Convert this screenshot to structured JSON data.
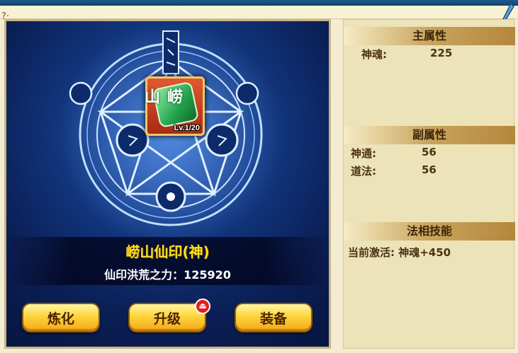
{
  "top_bar": {
    "corner_glyph": "?·"
  },
  "seal": {
    "icon_char": "崂山",
    "level": "Lv.1/20",
    "name": "崂山仙印(神)",
    "power_text": "仙印洪荒之力：125920"
  },
  "buttons": {
    "refine": "炼化",
    "upgrade": "升级",
    "equip": "装备",
    "upgrade_badge": "⏏"
  },
  "main_attr": {
    "title": "主属性",
    "rows": [
      {
        "label": "神魂:",
        "value": "225"
      }
    ]
  },
  "sub_attr": {
    "title": "副属性",
    "rows": [
      {
        "label": "神通:",
        "value": "56"
      },
      {
        "label": "道法:",
        "value": "56"
      }
    ]
  },
  "skill": {
    "title": "法相技能",
    "active_text": "当前激活: 神魂+450"
  },
  "colors": {
    "accent_gold": "#ffe020",
    "button_fill": "#ffd43a",
    "panel_bg": "#ece3b8"
  }
}
